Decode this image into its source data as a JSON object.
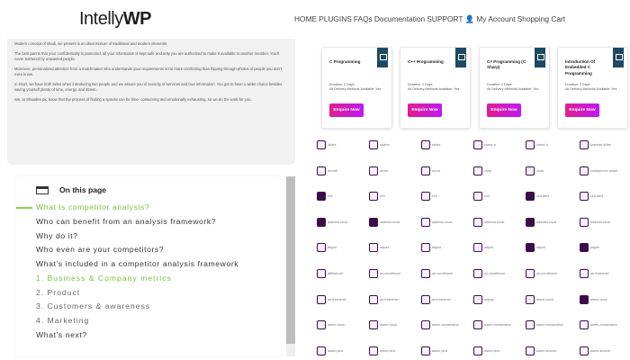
{
  "header": {
    "logo_main": "Intelly",
    "logo_bold": "WP",
    "nav": [
      "HOME",
      "PLUGINS",
      "FAQs",
      "Documentation",
      "SUPPORT",
      "👤 My Account",
      "Shopping Cart"
    ]
  },
  "article": {
    "paragraphs": [
      "Modern concept of shadi, we present is an ideal mixture of traditional and modern elements",
      "The best part is that your confidentiality is protected, all your information is kept safe and only you are authorized to make it available to another member. You’ll never bothered by unwanted people.",
      "Moreover, personalized attention from a matchmaker who understands your requirements is far more comforting than flipping through photos of people you don’t even know.",
      "In short, we have both sides when introducing two people and we assure you of security of services and true information. You get to have a wider choice besides saving yourself plenty of time, energy, and stress.",
      "We, at Shaadee.pk, know that the process of finding a spouse can be time- consuming and emotionally exhausting, so we do the work for you."
    ]
  },
  "toc": {
    "title": "On this page",
    "items": [
      {
        "text": "What is competitor analysis?",
        "class": "active"
      },
      {
        "text": "Who can benefit from an analysis framework?",
        "class": ""
      },
      {
        "text": "Why do it?",
        "class": ""
      },
      {
        "text": "Who even are your competitors?",
        "class": ""
      },
      {
        "text": "What’s included in a competitor analysis framework",
        "class": ""
      },
      {
        "text": "1. Business & Company metrics",
        "class": "subactive"
      },
      {
        "text": "2. Product",
        "class": "sub"
      },
      {
        "text": "3. Customers & awareness",
        "class": "sub"
      },
      {
        "text": "4. Marketing",
        "class": "sub"
      },
      {
        "text": "What’s next?",
        "class": ""
      }
    ]
  },
  "courses": [
    {
      "title": "C Programming",
      "duration": "Duration: 2 Days",
      "delivery": "All Delivery Methods Available: Yes",
      "button": "Enquire Now"
    },
    {
      "title": "C++ Programming",
      "duration": "Duration: 2 Days",
      "delivery": "All Delivery Methods Available: Yes",
      "button": "Enquire Now"
    },
    {
      "title": "C# Programming (C Sharp)",
      "duration": "Duration: 2 Days",
      "delivery": "All Delivery Methods Available: Yes",
      "button": "Enquire Now"
    },
    {
      "title": "Introduction Of Embedded C Programming",
      "duration": "Duration: 2 Days",
      "delivery": "All Delivery Methods Available: Yes",
      "button": "Enquire Now"
    }
  ],
  "icons": {
    "rows": [
      [
        {
          "label": "slides",
          "icon": "slides-icon",
          "style": "outline"
        },
        {
          "label": "sliders",
          "icon": "sliders-icon",
          "style": "outline"
        },
        {
          "label": "slides",
          "icon": "slides-icon",
          "style": "outline"
        },
        {
          "label": "chess a",
          "icon": "chess-icon",
          "style": "outline"
        },
        {
          "label": "chess b",
          "icon": "chess-icon",
          "style": "outline"
        },
        {
          "label": "bracelet-slider",
          "icon": "slider-icon",
          "style": "outline"
        }
      ],
      [
        {
          "label": "aircraft",
          "icon": "aircraft-icon",
          "style": "outline"
        },
        {
          "label": "arrow",
          "icon": "arrow-icon",
          "style": "outline"
        },
        {
          "label": "arrow",
          "icon": "arrow-icon",
          "style": "outline"
        },
        {
          "label": "clock",
          "icon": "clock-icon",
          "style": "outline"
        },
        {
          "label": "clock",
          "icon": "clock-icon",
          "style": "outline"
        },
        {
          "label": "smartphone-rotate",
          "icon": "phone-icon",
          "style": "outline"
        }
      ],
      [
        {
          "label": "cell",
          "icon": "cell-icon",
          "style": "solid"
        },
        {
          "label": "cell",
          "icon": "cell-icon",
          "style": "outline"
        },
        {
          "label": "cell",
          "icon": "cell-icon",
          "style": "outline"
        },
        {
          "label": "cell",
          "icon": "cell-icon",
          "style": "outline"
        },
        {
          "label": "cell-alert",
          "icon": "cell-alert-icon",
          "style": "solid"
        },
        {
          "label": "cell-alert",
          "icon": "cell-alert-icon",
          "style": "outline"
        }
      ],
      [
        {
          "label": "address-book",
          "icon": "address-book-icon",
          "style": "solid"
        },
        {
          "label": "address-book",
          "icon": "address-book-icon",
          "style": "solid"
        },
        {
          "label": "address-book",
          "icon": "address-book-icon",
          "style": "outline"
        },
        {
          "label": "address-book",
          "icon": "address-book-icon",
          "style": "outline"
        },
        {
          "label": "address-book",
          "icon": "address-book-icon",
          "style": "solid"
        },
        {
          "label": "address-book",
          "icon": "address-book-icon",
          "style": "outline"
        }
      ],
      [
        {
          "label": "adjust",
          "icon": "adjust-icon",
          "style": "outline"
        },
        {
          "label": "adjust",
          "icon": "adjust-icon",
          "style": "outline"
        },
        {
          "label": "adjust",
          "icon": "adjust-icon",
          "style": "outline"
        },
        {
          "label": "adjust",
          "icon": "adjust-icon",
          "style": "outline"
        },
        {
          "label": "adjust",
          "icon": "adjust-icon",
          "style": "solid"
        },
        {
          "label": "adjust",
          "icon": "adjust-icon",
          "style": "solid"
        }
      ],
      [
        {
          "label": "affiliate-alt",
          "icon": "affiliate-icon",
          "style": "outline"
        },
        {
          "label": "air-conditioner",
          "icon": "air-conditioner-icon",
          "style": "outline"
        },
        {
          "label": "air-conditioner",
          "icon": "air-conditioner-icon",
          "style": "outline"
        },
        {
          "label": "air-conditioner",
          "icon": "air-conditioner-icon",
          "style": "outline"
        },
        {
          "label": "air-conditioner",
          "icon": "air-conditioner-icon",
          "style": "outline"
        },
        {
          "label": "air-freshener",
          "icon": "air-freshener-icon",
          "style": "outline"
        }
      ],
      [
        {
          "label": "air-freshener",
          "icon": "air-freshener-icon",
          "style": "outline"
        },
        {
          "label": "air-freshener",
          "icon": "air-freshener-icon",
          "style": "outline"
        },
        {
          "label": "air-freshener",
          "icon": "air-freshener-icon",
          "style": "outline"
        },
        {
          "label": "airplay",
          "icon": "airplay-icon",
          "style": "outline"
        },
        {
          "label": "alarm-clock",
          "icon": "alarm-clock-icon",
          "style": "outline"
        },
        {
          "label": "alarm-clock",
          "icon": "alarm-clock-icon",
          "style": "solid"
        }
      ],
      [
        {
          "label": "alarm-clock",
          "icon": "alarm-clock-icon",
          "style": "outline"
        },
        {
          "label": "alarm-clock",
          "icon": "alarm-clock-icon",
          "style": "outline"
        },
        {
          "label": "alarm-exclamation",
          "icon": "alarm-exclamation-icon",
          "style": "outline"
        },
        {
          "label": "alarm-exclamation",
          "icon": "alarm-exclamation-icon",
          "style": "outline"
        },
        {
          "label": "alarm-exclamation",
          "icon": "alarm-exclamation-icon",
          "style": "outline"
        },
        {
          "label": "alarm-exclamation",
          "icon": "alarm-exclamation-icon",
          "style": "outline"
        }
      ],
      [
        {
          "label": "alarm-plus",
          "icon": "alarm-plus-icon",
          "style": "outline"
        },
        {
          "label": "alarm-plus",
          "icon": "alarm-plus-icon",
          "style": "outline"
        },
        {
          "label": "alarm-plus",
          "icon": "alarm-plus-icon",
          "style": "outline"
        },
        {
          "label": "alarm-plus",
          "icon": "alarm-plus-icon",
          "style": "outline"
        },
        {
          "label": "alarm-snooze",
          "icon": "alarm-snooze-icon",
          "style": "outline"
        },
        {
          "label": "alarm-snooze",
          "icon": "alarm-snooze-icon",
          "style": "outline"
        }
      ]
    ]
  },
  "colors": {
    "accent": "#8bd150",
    "brand_button_start": "#e11d8d",
    "brand_button_end": "#c019f5",
    "icon_purple": "#3b0e4b",
    "badge_navy": "#1f4a63"
  }
}
